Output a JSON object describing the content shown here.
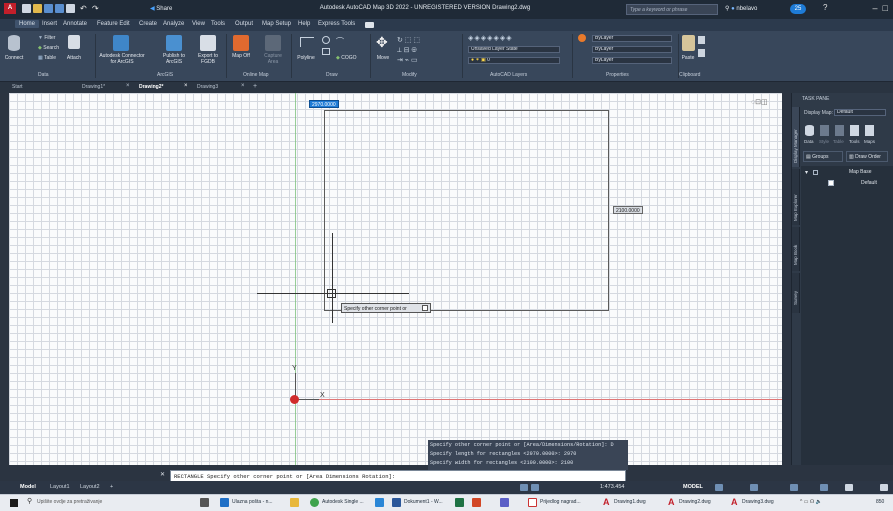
{
  "window": {
    "title": "Autodesk AutoCAD Map 3D 2022 - UNREGISTERED VERSION   Drawing2.dwg",
    "search_placeholder": "Type a keyword or phrase",
    "user": "nbelavo",
    "share_label": "Share",
    "badge_count": "25"
  },
  "menu": [
    "Home",
    "Insert",
    "Annotate",
    "Feature Edit",
    "Create",
    "Analyze",
    "View",
    "Tools",
    "Output",
    "Map Setup",
    "Help",
    "Express Tools"
  ],
  "ribbon": {
    "data": {
      "connect": "Connect",
      "filter": "Filter",
      "search": "Search",
      "table": "Table",
      "attach": "Attach",
      "title": "Data"
    },
    "arcgis": {
      "connector": "Autodesk Connector\nfor ArcGIS",
      "publish": "Publish to\nArcGIS",
      "export": "Export to\nFGDB",
      "title": "ArcGIS"
    },
    "online_map": {
      "map_off": "Map Off",
      "capture": "Capture\nArea",
      "title": "Online Map"
    },
    "draw": {
      "polyline": "Polyline",
      "cogo": "COGO",
      "title": "Draw"
    },
    "modify": {
      "move": "Move",
      "title": "Modify"
    },
    "layers": {
      "state": "Unsaved Layer State",
      "layer": "0",
      "title": "AutoCAD Layers"
    },
    "properties": {
      "bylayer1": "ByLayer",
      "bylayer2": "ByLayer",
      "bylayer3": "ByLayer",
      "title": "Properties"
    },
    "clipboard": {
      "paste": "Paste",
      "title": "Clipboard"
    }
  },
  "file_tabs": [
    "Start",
    "Drawing1*",
    "Drawing2*",
    "Drawing3"
  ],
  "active_file_tab": "Drawing2*",
  "canvas": {
    "dim_input_top": "2970.0000",
    "dim_input_right": "2100.0000",
    "tooltip": "Specify other corner point or",
    "axis_y": "Y",
    "axis_x": "X"
  },
  "task_pane": {
    "title": "TASK PANE",
    "display_map_label": "Display Map:",
    "display_map_value": "Default",
    "tools": [
      "Data",
      "Style",
      "Table",
      "Tools",
      "Maps"
    ],
    "groups": "Groups",
    "draw_order": "Draw Order",
    "map_base": "Map Base",
    "default_item": "Default",
    "side_tabs": [
      "Display Manager",
      "Map Explorer",
      "Map Book",
      "Survey"
    ]
  },
  "command": {
    "history": [
      "Specify other corner point or [Area/Dimensions/Rotation]: D",
      "Specify length for rectangles <2970.0000>: 2970",
      "Specify width for rectangles <2100.0000>: 2100"
    ],
    "current": "RECTANGLE Specify other corner point or [Area Dimensions Rotation]:"
  },
  "status": {
    "layout_tabs": [
      "Model",
      "Layout1",
      "Layout2"
    ],
    "scale": "1:473.454",
    "model": "MODEL"
  },
  "taskbar": {
    "search": "Upišite ovdje za pretraživanje",
    "items": [
      "Ulazna pošta - n...",
      "Autodesk Single ...",
      "Dokument1 - W...",
      "Prijedlog nagrad...",
      "Drawing1.dwg",
      "Drawing2.dwg",
      "Drawing3.dwg"
    ],
    "time": "850"
  },
  "colors": {
    "accent": "#1e7bd6",
    "canvas": "#fafbfc",
    "grid": "#d5d9e0",
    "ribbon": "#38475b",
    "ucs_red": "#d12b2b"
  }
}
